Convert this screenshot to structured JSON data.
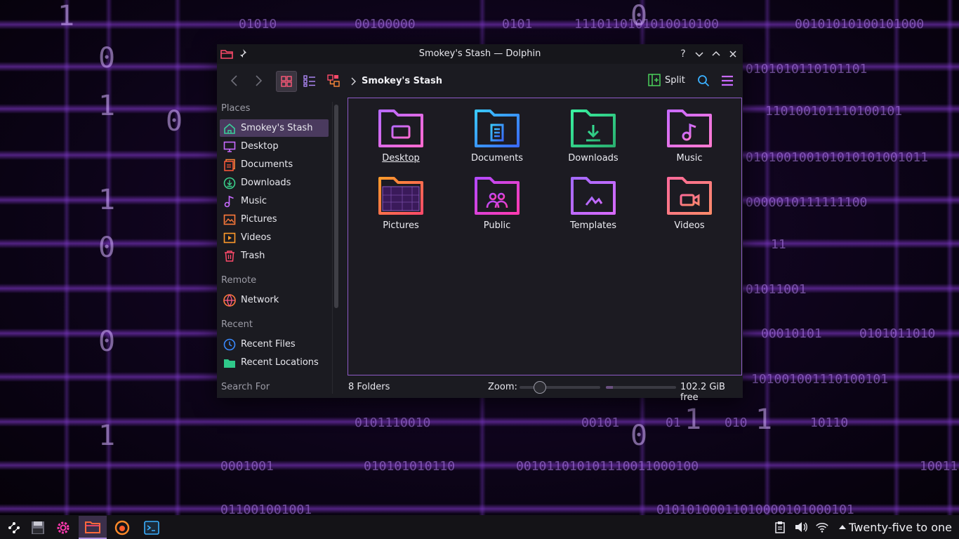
{
  "window": {
    "title": "Smokey's Stash — Dolphin",
    "help": "?"
  },
  "toolbar": {
    "breadcrumb": "Smokey's Stash",
    "split_label": "Split"
  },
  "sidebar": {
    "sections": {
      "places": "Places",
      "remote": "Remote",
      "recent": "Recent",
      "search": "Search For"
    },
    "places": [
      {
        "label": "Smokey's Stash",
        "icon": "home-icon",
        "selected": true
      },
      {
        "label": "Desktop",
        "icon": "desktop-icon"
      },
      {
        "label": "Documents",
        "icon": "documents-icon"
      },
      {
        "label": "Downloads",
        "icon": "downloads-icon"
      },
      {
        "label": "Music",
        "icon": "music-icon"
      },
      {
        "label": "Pictures",
        "icon": "pictures-icon"
      },
      {
        "label": "Videos",
        "icon": "videos-icon"
      },
      {
        "label": "Trash",
        "icon": "trash-icon"
      }
    ],
    "remote": [
      {
        "label": "Network",
        "icon": "network-icon"
      }
    ],
    "recent": [
      {
        "label": "Recent Files",
        "icon": "recent-files-icon"
      },
      {
        "label": "Recent Locations",
        "icon": "recent-locations-icon"
      }
    ]
  },
  "folders": [
    {
      "name": "Desktop",
      "icon": "desktop-folder-icon"
    },
    {
      "name": "Documents",
      "icon": "documents-folder-icon"
    },
    {
      "name": "Downloads",
      "icon": "downloads-folder-icon"
    },
    {
      "name": "Music",
      "icon": "music-folder-icon"
    },
    {
      "name": "Pictures",
      "icon": "pictures-folder-icon"
    },
    {
      "name": "Public",
      "icon": "public-folder-icon"
    },
    {
      "name": "Templates",
      "icon": "templates-folder-icon"
    },
    {
      "name": "Videos",
      "icon": "videos-folder-icon"
    }
  ],
  "statusbar": {
    "count": "8 Folders",
    "zoom_label": "Zoom:",
    "free_space": "102.2 GiB free",
    "zoom_level": 0.25,
    "disk_used_fraction": 0.1
  },
  "taskbar": {
    "clock": "Twenty-five to one"
  },
  "wallpaper": {
    "strings": [
      "01010",
      "00100000",
      "0101",
      "1110110101010010100",
      "00101010100101000",
      "0101010110101101",
      "110100101110100101",
      "010100100101010101001011",
      "0000010111111100",
      "11",
      "01011001",
      "00010101",
      "0101011010",
      "101001001110100101",
      "0101110010",
      "01",
      "010",
      "00101",
      "10110",
      "0001001",
      "010101010110",
      "001011010101110011000100",
      "10011",
      "011001001001",
      "01010100011010000101000101"
    ],
    "digits": [
      "1",
      "0",
      "1",
      "0",
      "1",
      "0",
      "1",
      "0",
      "1",
      "0",
      "1",
      "0"
    ]
  },
  "colors": {
    "accent": "#8f5bc7",
    "selection": "#4a3a5e"
  }
}
